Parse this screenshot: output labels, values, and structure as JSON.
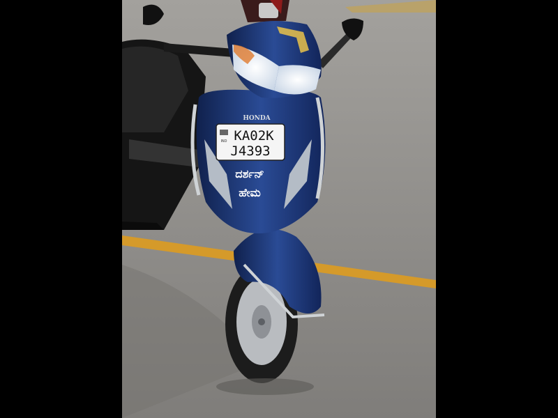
{
  "image": {
    "description": "",
    "scooter": {
      "brand_badge": "HONDA",
      "plate_line1": "KA02K",
      "plate_line2": "J4393",
      "plate_small": "IND",
      "front_sticker_line1": "ದರ್ಶನ್",
      "front_sticker_line2": "ಹೇಮ",
      "body_color": "#1f3a7a"
    },
    "colors": {
      "floor": "#8d8b88",
      "lane_line": "#d59a2a",
      "letterbox": "#000000"
    }
  }
}
